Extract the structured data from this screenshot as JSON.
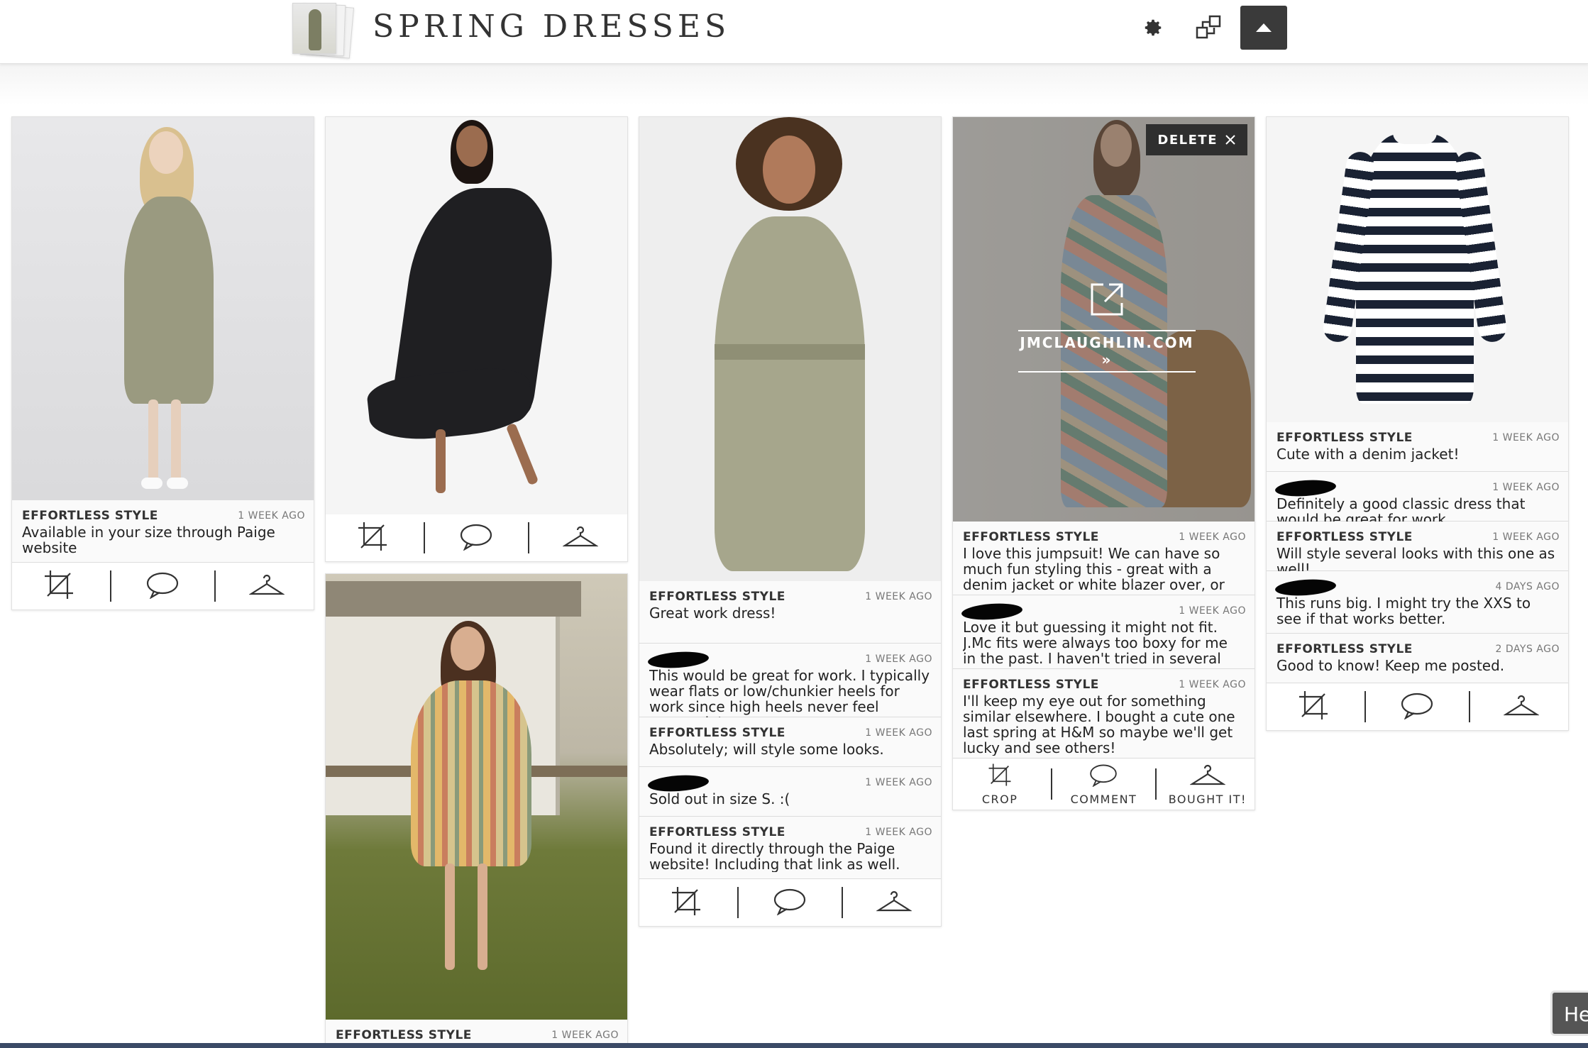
{
  "header": {
    "board_title": "SPRING DRESSES",
    "icons": [
      "gear-icon",
      "share-icon",
      "collapse-up-icon"
    ]
  },
  "actions": {
    "crop": "CROP",
    "comment": "COMMENT",
    "bought": "BOUGHT IT!"
  },
  "cards": [
    {
      "id": "khaki-shirt-dress",
      "comments": [
        {
          "author": "EFFORTLESS STYLE",
          "time": "1 WEEK AGO",
          "text": "Available in your size through Paige website"
        }
      ]
    },
    {
      "id": "black-midi-dress",
      "comments": []
    },
    {
      "id": "striped-boho-dress",
      "comments": [
        {
          "author": "EFFORTLESS STYLE",
          "time": "1 WEEK AGO",
          "text": ""
        }
      ]
    },
    {
      "id": "olive-belted-dress",
      "comments": [
        {
          "author": "EFFORTLESS STYLE",
          "time": "1 WEEK AGO",
          "text": "Great work dress!"
        },
        {
          "author": "",
          "time": "1 WEEK AGO",
          "text": "This would be great for work. I typically wear flats or low/chunkier heels for work since high heels never feel appropriate"
        },
        {
          "author": "EFFORTLESS STYLE",
          "time": "1 WEEK AGO",
          "text": "Absolutely; will style some looks."
        },
        {
          "author": "",
          "time": "1 WEEK AGO",
          "text": "Sold out in size S. :("
        },
        {
          "author": "EFFORTLESS STYLE",
          "time": "1 WEEK AGO",
          "text": "Found it directly through the Paige website! Including that link as well."
        }
      ]
    },
    {
      "id": "floral-jumpsuit",
      "delete_label": "DELETE",
      "link_domain": "JMCLAUGHLIN.COM »",
      "comments": [
        {
          "author": "EFFORTLESS STYLE",
          "time": "1 WEEK AGO",
          "text": "I love this jumpsuit! We can have so much fun styling this - great with a denim jacket or white blazer over, or"
        },
        {
          "author": "",
          "time": "1 WEEK AGO",
          "text": "Love it but guessing it might not fit. J.Mc fits were always too boxy for me in the past. I haven't tried in several years"
        },
        {
          "author": "EFFORTLESS STYLE",
          "time": "1 WEEK AGO",
          "text": "I'll keep my eye out for something similar elsewhere. I bought a cute one last spring at H&M so maybe we'll get lucky and see others!"
        }
      ]
    },
    {
      "id": "striped-tshirt-dress",
      "comments": [
        {
          "author": "EFFORTLESS STYLE",
          "time": "1 WEEK AGO",
          "text": "Cute with a denim jacket!"
        },
        {
          "author": "",
          "time": "1 WEEK AGO",
          "text": "Definitely a good classic dress that would be great for work."
        },
        {
          "author": "EFFORTLESS STYLE",
          "time": "1 WEEK AGO",
          "text": "Will style several looks with this one as well!"
        },
        {
          "author": "",
          "time": "4 DAYS AGO",
          "text": "This runs big. I might try the XXS to see if that works better."
        },
        {
          "author": "EFFORTLESS STYLE",
          "time": "2 DAYS AGO",
          "text": "Good to know! Keep me posted."
        }
      ]
    }
  ],
  "help": {
    "label": "He"
  }
}
